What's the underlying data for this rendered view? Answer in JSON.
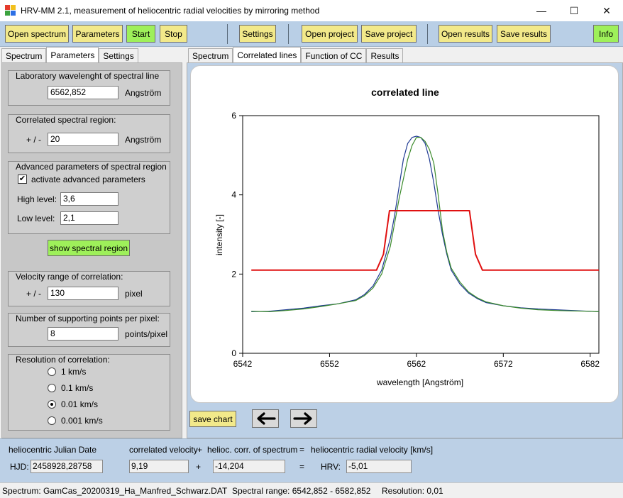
{
  "window": {
    "title": "HRV-MM 2.1,   measurement of heliocentric radial velocities by mirroring method",
    "minimize": "—",
    "maximize": "☐",
    "close": "✕"
  },
  "toolbar": {
    "open_spectrum": "Open spectrum",
    "parameters": "Parameters",
    "start": "Start",
    "stop": "Stop",
    "settings": "Settings",
    "open_project": "Open project",
    "save_project": "Save project",
    "open_results": "Open results",
    "save_results": "Save results",
    "info": "Info"
  },
  "left_tabs": [
    "Spectrum",
    "Parameters",
    "Settings"
  ],
  "params": {
    "lab_wavelength": {
      "title": "Laboratory wavelenght of spectral line",
      "value": "6562,852",
      "unit": "Angström"
    },
    "correlated_region": {
      "title": "Correlated spectral region:",
      "prefix": "+ / -",
      "value": "20",
      "unit": "Angström"
    },
    "advanced": {
      "title": "Advanced parameters of spectral region",
      "activate_label": "activate advanced parameters",
      "activate_checked": "✔",
      "high_label": "High level:",
      "high_value": "3,6",
      "low_label": "Low level:",
      "low_value": "2,1"
    },
    "show_region": "show spectral region",
    "velocity_range": {
      "title": "Velocity range of correlation:",
      "prefix": "+ / -",
      "value": "130",
      "unit": "pixel"
    },
    "supporting_points": {
      "title": "Number of supporting points per pixel:",
      "value": "8",
      "unit": "points/pixel"
    },
    "resolution": {
      "title": "Resolution of correlation:",
      "options": [
        "1 km/s",
        "0.1 km/s",
        "0.01 km/s",
        "0.001 km/s"
      ],
      "selected_index": 2
    }
  },
  "right_tabs": [
    "Spectrum",
    "Correlated lines",
    "Function of CC",
    "Results"
  ],
  "right_tab_active": 1,
  "chart_data": {
    "type": "line",
    "title": "correlated line",
    "xlabel": "wavelength [Angström]",
    "ylabel": "intensity [-]",
    "xlim": [
      6542,
      6583
    ],
    "ylim": [
      0,
      6
    ],
    "xticks": [
      "6542",
      "6552",
      "6562",
      "6572",
      "6582"
    ],
    "yticks": [
      "0",
      "2",
      "4",
      "6"
    ],
    "series": [
      {
        "color": "#1f3a93",
        "x": [
          6543,
          6545,
          6547,
          6549,
          6551,
          6553,
          6555,
          6556,
          6557,
          6558,
          6559,
          6559.5,
          6560,
          6560.5,
          6561,
          6561.5,
          6562,
          6562.5,
          6563,
          6563.5,
          6564,
          6564.5,
          6565,
          6565.5,
          6566,
          6567,
          6568,
          6569,
          6570,
          6572,
          6574,
          6576,
          6578,
          6580,
          6582,
          6583
        ],
        "y": [
          1.05,
          1.06,
          1.1,
          1.14,
          1.2,
          1.25,
          1.35,
          1.48,
          1.7,
          2.1,
          2.9,
          3.5,
          4.2,
          4.9,
          5.3,
          5.45,
          5.48,
          5.45,
          5.3,
          4.9,
          4.3,
          3.6,
          3.0,
          2.5,
          2.1,
          1.75,
          1.52,
          1.38,
          1.28,
          1.2,
          1.15,
          1.12,
          1.1,
          1.08,
          1.06,
          1.05
        ]
      },
      {
        "color": "#3a8a2a",
        "x": [
          6543,
          6545,
          6547,
          6549,
          6551,
          6553,
          6555,
          6556,
          6557,
          6558,
          6559,
          6559.5,
          6560,
          6560.5,
          6561,
          6561.5,
          6562,
          6562.5,
          6563,
          6563.5,
          6564,
          6564.5,
          6565,
          6565.5,
          6566,
          6567,
          6568,
          6569,
          6570,
          6572,
          6574,
          6576,
          6578,
          6580,
          6582,
          6583
        ],
        "y": [
          1.06,
          1.05,
          1.08,
          1.12,
          1.18,
          1.25,
          1.33,
          1.45,
          1.65,
          2.0,
          2.7,
          3.3,
          3.9,
          4.4,
          4.9,
          5.25,
          5.45,
          5.45,
          5.35,
          5.15,
          4.8,
          4.0,
          3.1,
          2.55,
          2.15,
          1.8,
          1.55,
          1.4,
          1.3,
          1.2,
          1.14,
          1.1,
          1.08,
          1.07,
          1.06,
          1.05
        ]
      },
      {
        "color": "#e01010",
        "x": [
          6543,
          6557.4,
          6558.2,
          6558.9,
          6568.1,
          6568.8,
          6569.6,
          6583
        ],
        "y": [
          2.1,
          2.1,
          2.5,
          3.6,
          3.6,
          2.5,
          2.1,
          2.1
        ]
      }
    ]
  },
  "buttons": {
    "save_chart": "save chart",
    "prev_arrow": "left-arrow-icon",
    "next_arrow": "right-arrow-icon"
  },
  "results": {
    "hjd_header": "heliocentric Julian Date",
    "corr_velocity_header": "correlated velocity",
    "plus1": "+",
    "helioc_corr_header": "helioc. corr. of spectrum",
    "equals1": "=",
    "hrv_header": "heliocentric radial velocity [km/s]",
    "hjd_label": "HJD:",
    "hjd_value": "2458928,28758",
    "corr_velocity_value": "9,19",
    "plus2": "+",
    "helioc_corr_value": "-14,204",
    "equals2": "=",
    "hrv_label": "HRV:",
    "hrv_value": "-5,01"
  },
  "status": {
    "spectrum": "Spectrum:  GamCas_20200319_Ha_Manfred_Schwarz.DAT",
    "range": "Spectral range:  6542,852 - 6582,852",
    "resolution": "Resolution:  0,01"
  }
}
